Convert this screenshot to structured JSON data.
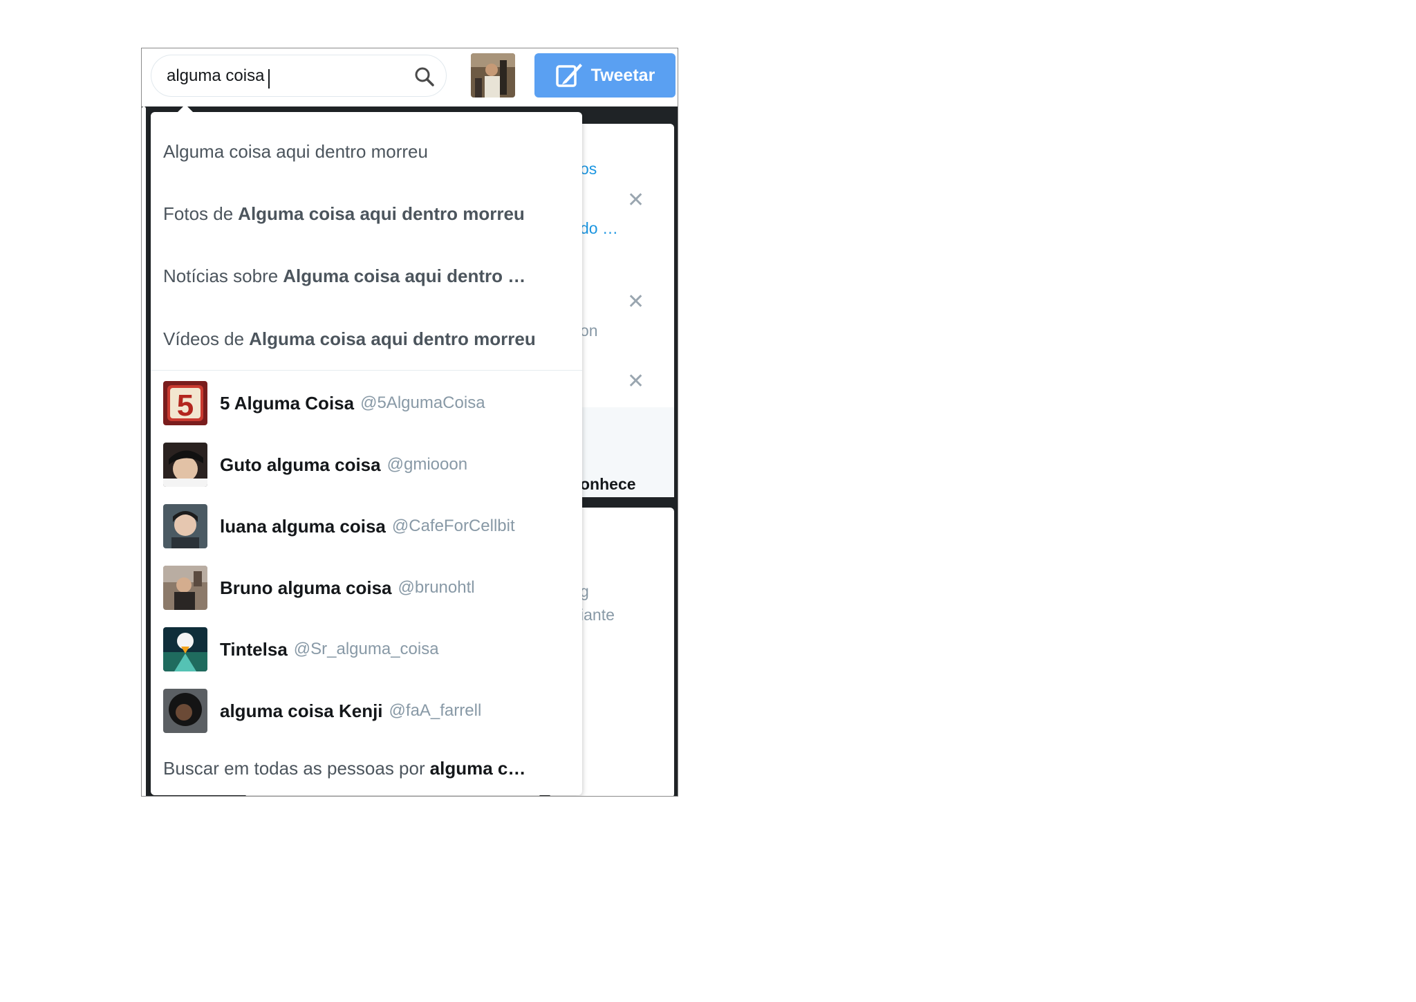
{
  "search": {
    "value": "alguma coisa",
    "icon": "search-icon"
  },
  "header": {
    "tweet_label": "Tweetar",
    "tweet_color": "#5aa0f2"
  },
  "suggestions": [
    {
      "prefix": "Alguma coisa aqui dentro morreu",
      "bold": ""
    },
    {
      "prefix": "Fotos de",
      "bold": "Alguma coisa aqui dentro morreu"
    },
    {
      "prefix": "Notícias sobre",
      "bold": "Alguma coisa aqui dentro …"
    },
    {
      "prefix": "Vídeos de",
      "bold": "Alguma coisa aqui dentro morreu"
    }
  ],
  "accounts": [
    {
      "name": "5 Alguma Coisa",
      "handle": "@5AlgumaCoisa"
    },
    {
      "name": "Guto alguma coisa",
      "handle": "@gmiooon"
    },
    {
      "name": "luana alguma coisa",
      "handle": "@CafeForCellbit"
    },
    {
      "name": "Bruno alguma coisa",
      "handle": "@brunohtl"
    },
    {
      "name": "Tintelsa",
      "handle": "@Sr_alguma_coisa"
    },
    {
      "name": "alguma coisa Kenji",
      "handle": "@faA_farrell"
    }
  ],
  "search_all": {
    "prefix": "Buscar em todas as pessoas por",
    "bold": "alguma c…"
  },
  "background": {
    "fragment_1": "os",
    "fragment_2": "do …",
    "fragment_3": "on",
    "fragment_4": "onhece",
    "fragment_5": "g",
    "fragment_6": "iante"
  }
}
